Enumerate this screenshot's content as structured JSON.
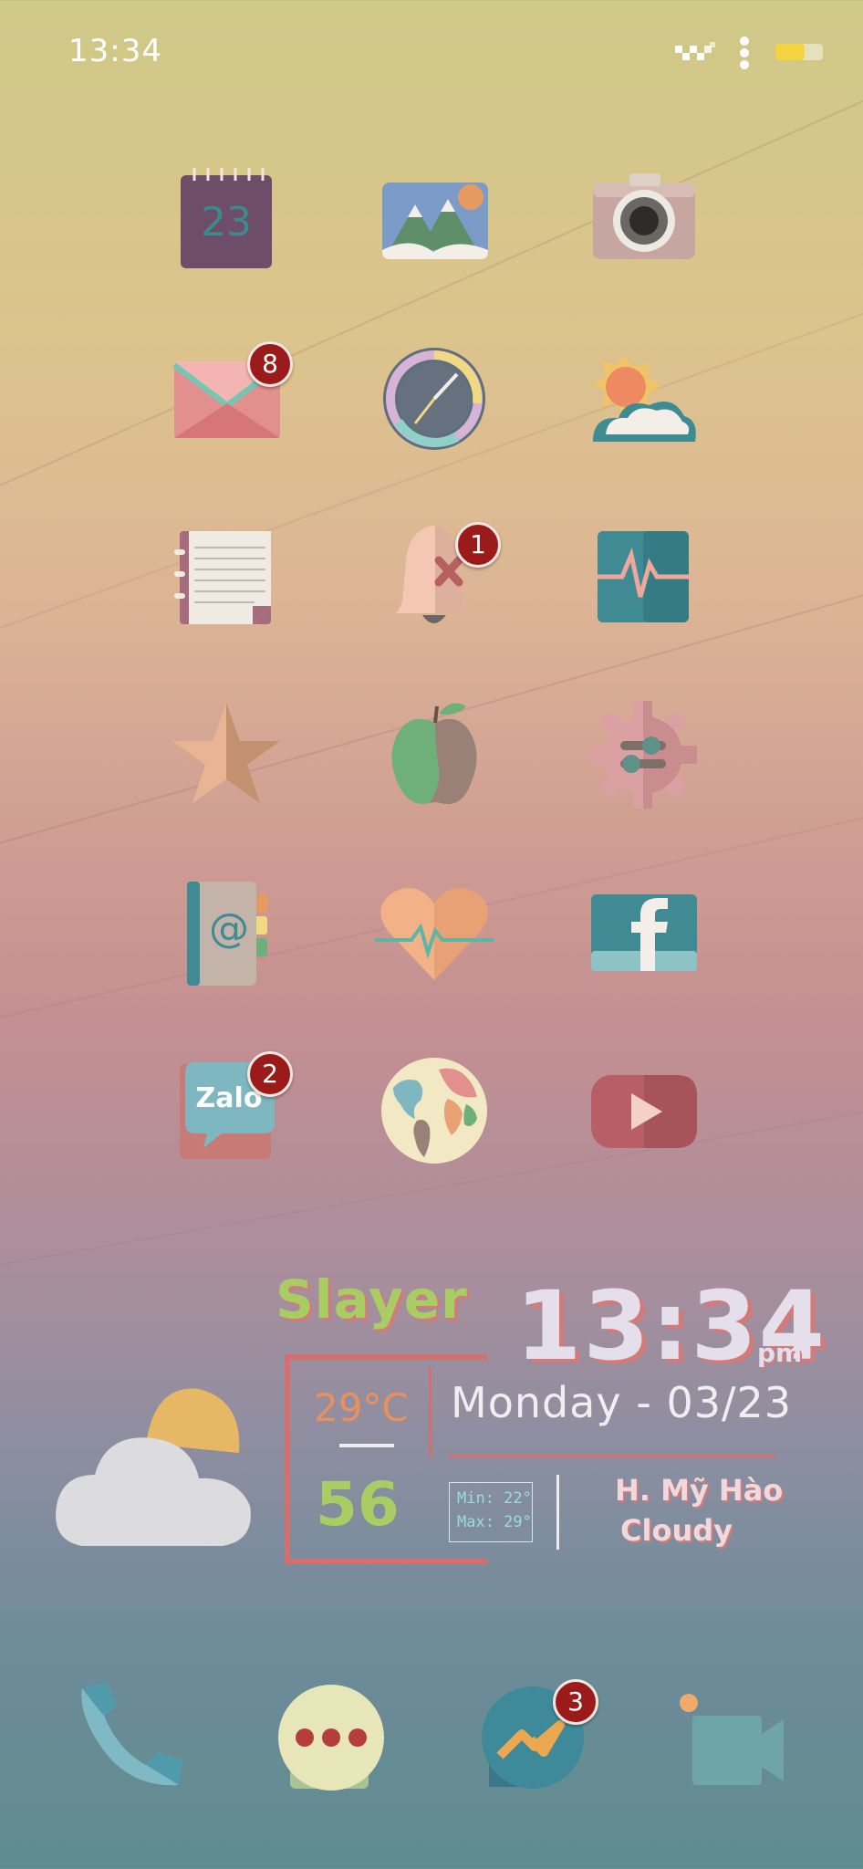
{
  "status_bar": {
    "time": "13:34",
    "icons": [
      "signal-icon",
      "menu-dots-icon",
      "battery-icon"
    ],
    "battery_color": "#f3d340"
  },
  "home_grid": [
    {
      "name": "calendar-app",
      "icon": "calendar-icon",
      "text": "23"
    },
    {
      "name": "gallery-app",
      "icon": "mountains-photo-icon"
    },
    {
      "name": "camera-app",
      "icon": "camera-icon"
    },
    {
      "name": "mail-app",
      "icon": "envelope-icon",
      "badge": "8"
    },
    {
      "name": "clock-app",
      "icon": "clock-icon"
    },
    {
      "name": "weather-app",
      "icon": "sun-cloud-icon"
    },
    {
      "name": "notes-app",
      "icon": "notebook-icon"
    },
    {
      "name": "notifications-app",
      "icon": "bell-muted-icon",
      "badge": "1"
    },
    {
      "name": "health-monitor-app",
      "icon": "pulse-icon"
    },
    {
      "name": "favorites-app",
      "icon": "star-icon"
    },
    {
      "name": "apple-app",
      "icon": "apple-icon"
    },
    {
      "name": "settings-app",
      "icon": "gear-icon"
    },
    {
      "name": "contacts-app",
      "icon": "address-book-icon",
      "text": "@"
    },
    {
      "name": "heart-rate-app",
      "icon": "heart-pulse-icon"
    },
    {
      "name": "facebook-app",
      "icon": "facebook-icon",
      "text": "f"
    },
    {
      "name": "zalo-app",
      "icon": "zalo-icon",
      "text": "Zalo",
      "badge": "2"
    },
    {
      "name": "globe-app",
      "icon": "globe-icon"
    },
    {
      "name": "youtube-app",
      "icon": "play-icon"
    }
  ],
  "widget": {
    "title": "Slayer",
    "time": "13:34",
    "ampm": "pm",
    "temperature": "29°C",
    "humidity": "56",
    "date": "Monday - 03/23",
    "min": "Min: 22°",
    "max": "Max: 29°",
    "location": "H. Mỹ Hào",
    "condition": "Cloudy",
    "weather_icon": "cloud-sun-icon"
  },
  "dock": [
    {
      "name": "phone-app",
      "icon": "phone-icon"
    },
    {
      "name": "messages-app",
      "icon": "chat-dots-icon"
    },
    {
      "name": "messenger-app",
      "icon": "messenger-icon",
      "badge": "3"
    },
    {
      "name": "video-call-app",
      "icon": "video-camera-icon"
    }
  ],
  "colors": {
    "accent_green": "#a9cc63",
    "accent_coral": "#d37a7a",
    "badge_red": "#9b1b1b"
  }
}
